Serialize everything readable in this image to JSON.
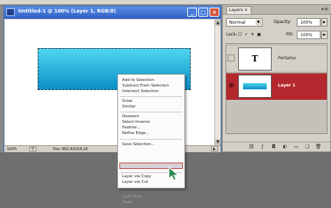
{
  "document": {
    "title": "Untitled-1 @ 100% (Layer 1, RGB/8)",
    "window_buttons": {
      "minimize": "_",
      "maximize": "□",
      "close": "×"
    },
    "status": {
      "zoom": "100%",
      "doc_info": "Doc: 802,4/1016,1K"
    }
  },
  "context_menu": {
    "items": [
      {
        "label": "Add to Selection",
        "disabled": false
      },
      {
        "label": "Subtract From Selection",
        "disabled": false
      },
      {
        "label": "Intersect Selection",
        "disabled": false
      },
      {
        "label": "Grow",
        "disabled": false
      },
      {
        "label": "Similar",
        "disabled": false
      },
      {
        "label": "Deselect",
        "disabled": false
      },
      {
        "label": "Select Inverse",
        "disabled": false
      },
      {
        "label": "Feather...",
        "disabled": false
      },
      {
        "label": "Refine Edge...",
        "disabled": false
      },
      {
        "label": "Save Selection...",
        "disabled": false
      },
      {
        "label": "Make Work Path...",
        "disabled": false,
        "highlighted": true
      },
      {
        "label": "Layer via Copy",
        "disabled": false
      },
      {
        "label": "Layer via Cut",
        "disabled": false
      },
      {
        "label": "Last Filter",
        "disabled": true
      },
      {
        "label": "Fade...",
        "disabled": true
      }
    ]
  },
  "layers_panel": {
    "tab_label": "Layers ×",
    "menu_icon": "▸≡",
    "blend_mode": "Normal",
    "opacity_label": "Opacity:",
    "opacity_value": "100%",
    "lock_label": "Lock:",
    "lock_icons": "☐ ✓ ✛ ▣",
    "fill_label": "Fill:",
    "fill_value": "100%",
    "layers": [
      {
        "name": "Pertama",
        "thumb": "T",
        "visible": false,
        "selected": false
      },
      {
        "name": "Layer 1",
        "visible": true,
        "selected": true
      }
    ],
    "footer_icons": [
      "link-icon",
      "fx-icon",
      "mask-icon",
      "adjustment-icon",
      "group-icon",
      "new-layer-icon",
      "trash-icon"
    ]
  },
  "colors": {
    "selected_layer": "#b3282c",
    "gradient_top": "#4fd6f0",
    "gradient_bottom": "#0a8fc7",
    "title_bar": "#2f5fc2"
  }
}
